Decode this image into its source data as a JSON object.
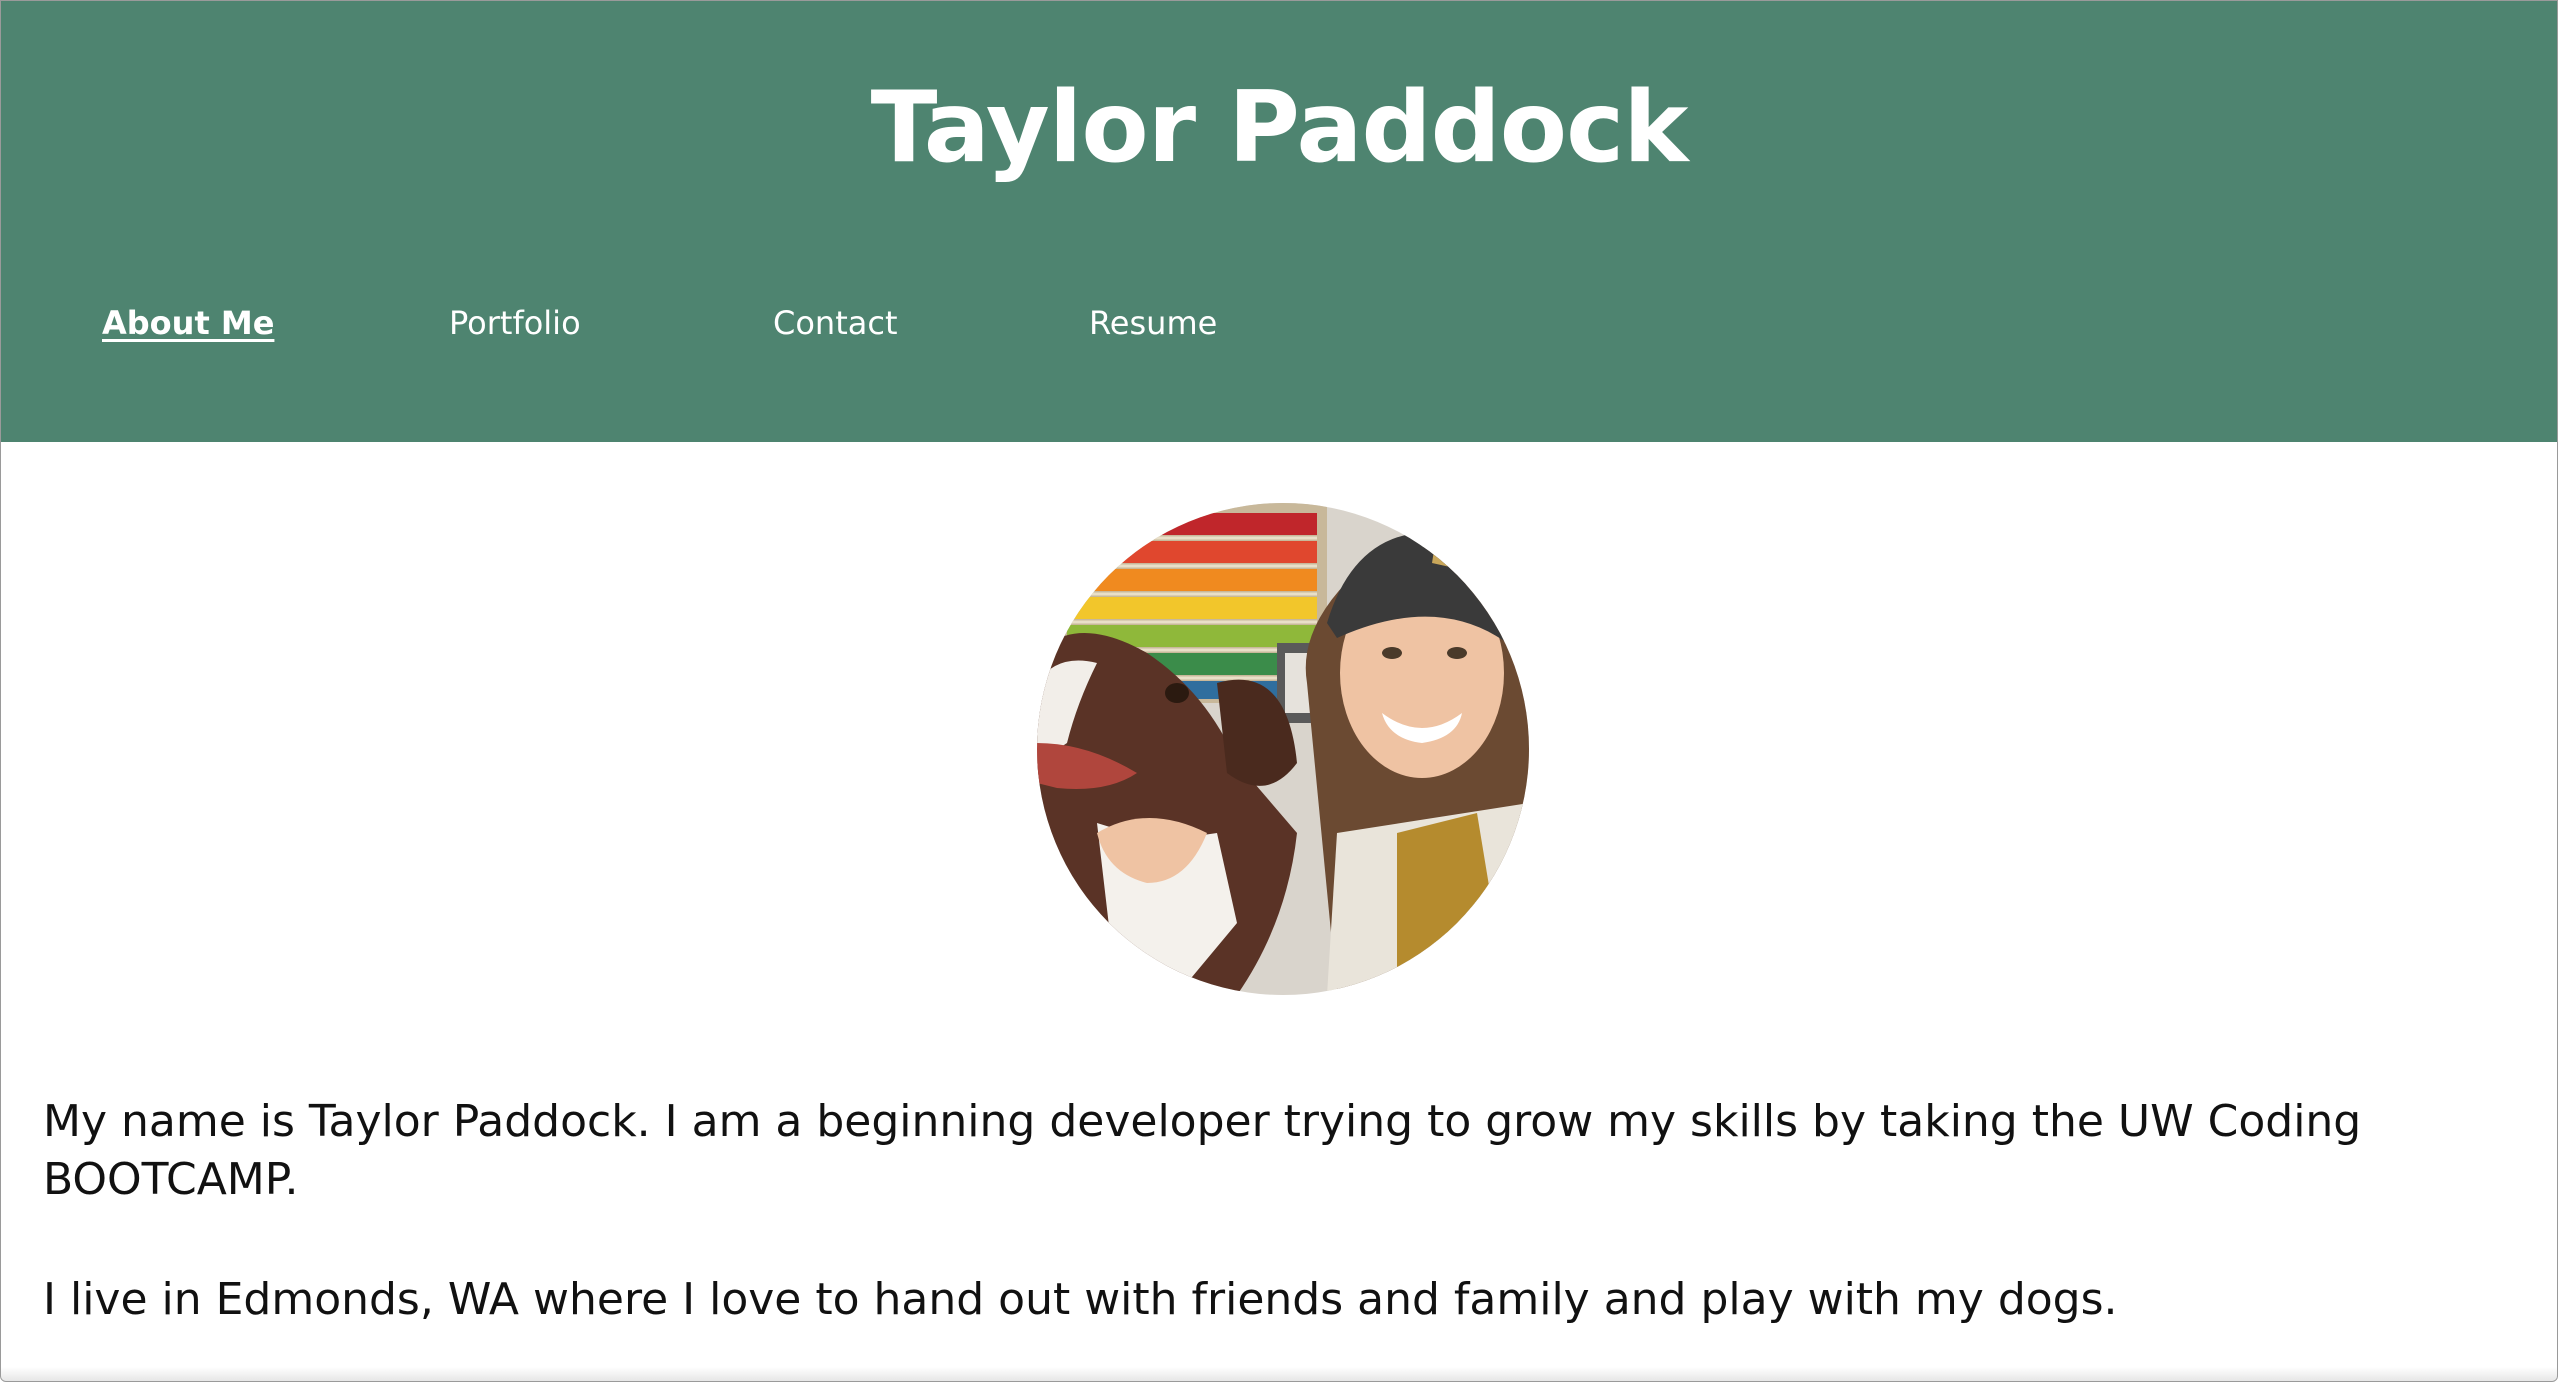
{
  "header": {
    "title": "Taylor Paddock",
    "background_color": "#4e8470"
  },
  "nav": {
    "items": [
      {
        "label": "About Me",
        "active": true
      },
      {
        "label": "Portfolio",
        "active": false
      },
      {
        "label": "Contact",
        "active": false
      },
      {
        "label": "Resume",
        "active": false
      }
    ]
  },
  "profile": {
    "photo_subject": "photo of smiling woman in beanie hugging a brown and white dog in front of shelves of colorful yarn"
  },
  "bio": {
    "paragraphs": [
      "My name is Taylor Paddock. I am a beginning developer trying to grow my skills by taking the UW Coding BOOTCAMP.",
      "I live in Edmonds, WA where I love to hand out with friends and family and play with my dogs."
    ]
  }
}
